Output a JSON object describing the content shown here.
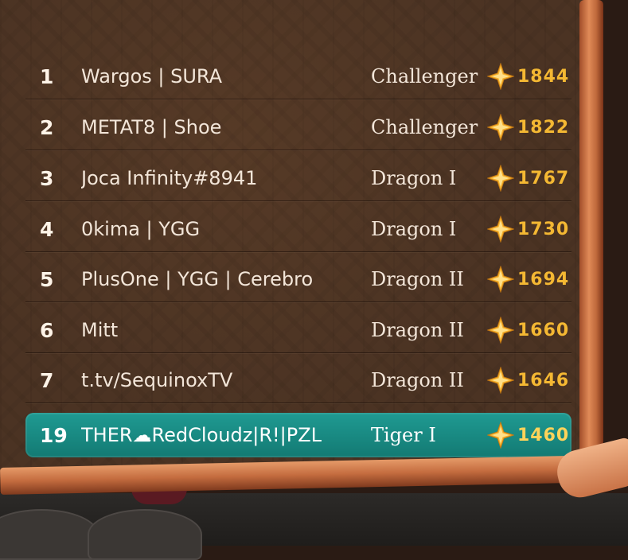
{
  "leaderboard": {
    "rows": [
      {
        "rank": "1",
        "name": "Wargos | SURA",
        "tier": "Challenger",
        "score": "1844"
      },
      {
        "rank": "2",
        "name": "METAT8 | Shoe",
        "tier": "Challenger",
        "score": "1822"
      },
      {
        "rank": "3",
        "name": "Joca Infinity#8941",
        "tier": "Dragon I",
        "score": "1767"
      },
      {
        "rank": "4",
        "name": "0kima | YGG",
        "tier": "Dragon I",
        "score": "1730"
      },
      {
        "rank": "5",
        "name": "PlusOne | YGG | Cerebro",
        "tier": "Dragon II",
        "score": "1694"
      },
      {
        "rank": "6",
        "name": "Mitt",
        "tier": "Dragon II",
        "score": "1660"
      },
      {
        "rank": "7",
        "name": "t.tv/SequinoxTV",
        "tier": "Dragon II",
        "score": "1646"
      }
    ],
    "current_player": {
      "rank": "19",
      "name": "THER☁RedCloudz|R!|PZL",
      "tier": "Tiger I",
      "score": "1460"
    }
  },
  "icons": {
    "score": "gold-star-icon"
  },
  "colors": {
    "highlight": "#1a8c85",
    "score": "#f4b833",
    "board": "#4b3323"
  }
}
